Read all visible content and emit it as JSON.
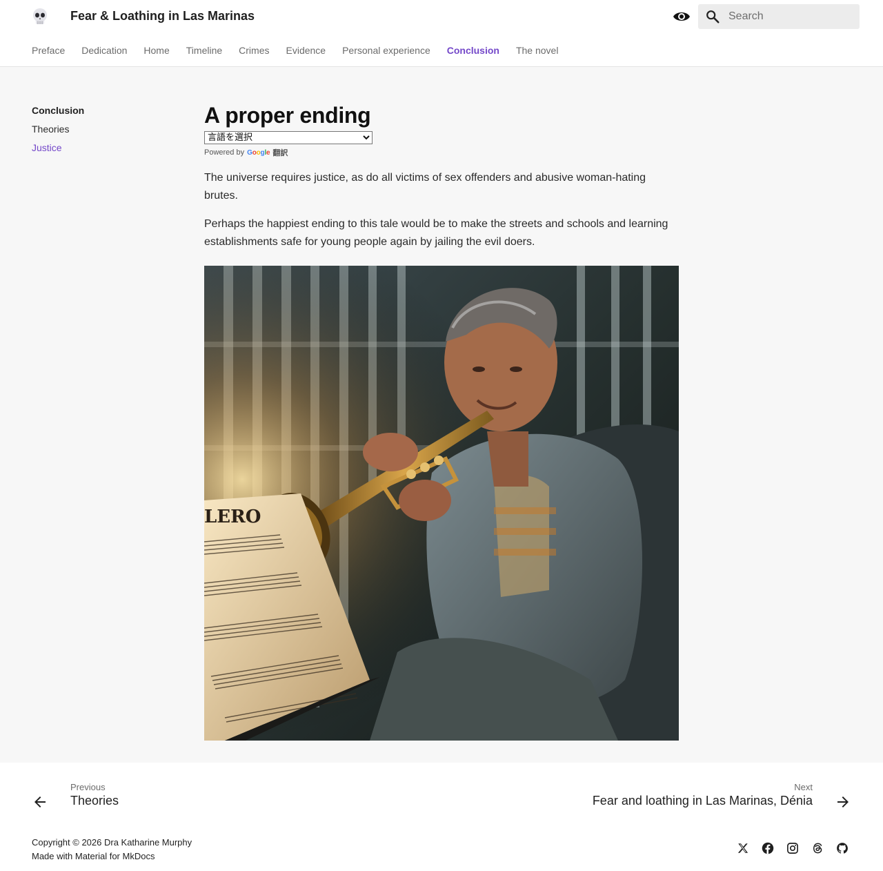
{
  "header": {
    "title": "Fear & Loathing in Las Marinas",
    "logo_icon": "skull-icon",
    "theme_toggle_icon": "eye-icon",
    "search": {
      "placeholder": "Search",
      "value": ""
    }
  },
  "tabs": [
    {
      "label": "Preface",
      "active": false
    },
    {
      "label": "Dedication",
      "active": false
    },
    {
      "label": "Home",
      "active": false
    },
    {
      "label": "Timeline",
      "active": false
    },
    {
      "label": "Crimes",
      "active": false
    },
    {
      "label": "Evidence",
      "active": false
    },
    {
      "label": "Personal experience",
      "active": false
    },
    {
      "label": "Conclusion",
      "active": true
    },
    {
      "label": "The novel",
      "active": false
    }
  ],
  "sidebar": {
    "title": "Conclusion",
    "items": [
      {
        "label": "Theories",
        "active": false
      },
      {
        "label": "Justice",
        "active": true
      }
    ]
  },
  "article": {
    "title": "A proper ending",
    "translate": {
      "selected": "言語を選択",
      "powered_by": "Powered by",
      "google": "Google",
      "translate_label": "翻訳"
    },
    "paragraphs": [
      "The universe requires justice, as do all victims of sex offenders and abusive woman-hating brutes.",
      "Perhaps the happiest ending to this tale would be to make the streets and schools and learning establishments safe for young people again by jailing the evil doers."
    ],
    "image_sheet_text": "LERO"
  },
  "footer_nav": {
    "previous": {
      "direction": "Previous",
      "title": "Theories"
    },
    "next": {
      "direction": "Next",
      "title": "Fear and loathing in Las Marinas, Dénia"
    }
  },
  "footer": {
    "copyright": "Copyright © 2026 Dra Katharine Murphy",
    "made_with": "Made with Material for MkDocs",
    "social": [
      "x-icon",
      "facebook-icon",
      "instagram-icon",
      "threads-icon",
      "github-icon"
    ]
  },
  "colors": {
    "accent": "#7448c9",
    "text": "#1f1f1f",
    "muted": "#6b6b6b",
    "content_bg": "#f7f7f7"
  }
}
